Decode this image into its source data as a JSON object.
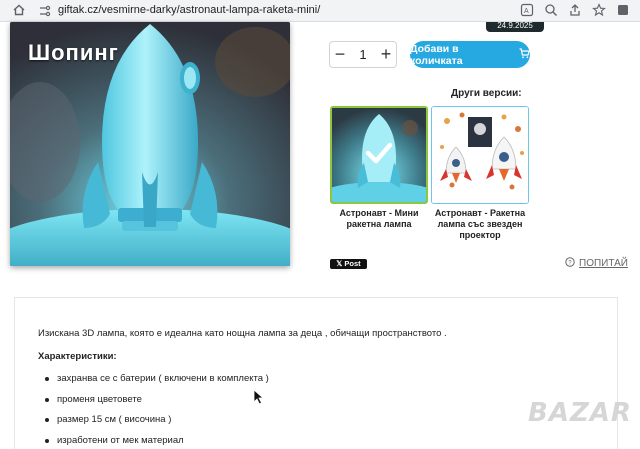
{
  "browser": {
    "url": "giftak.cz/vesmirne-darky/astronaut-lampa-raketa-mini/"
  },
  "product": {
    "shop_badge": "Шопинг",
    "date_chip": "24.9.2025",
    "quantity": "1",
    "qty_minus": "−",
    "qty_plus": "+",
    "add_to_cart_label": "Добави в количката"
  },
  "versions": {
    "title": "Други версии:",
    "items": [
      {
        "label": "Астронавт - Мини ракетна лампа",
        "selected": true
      },
      {
        "label": "Астронавт - Ракетна лампа със звезден проектор",
        "selected": false
      }
    ]
  },
  "social": {
    "post_label": "𝕏 Post",
    "ask_label": "ПОПИТАЙ"
  },
  "description": {
    "text": "Изискана 3D лампа, която е идеална като нощна лампа за деца , обичащи пространството .",
    "characteristics_title": "Характеристики:",
    "features": [
      "захранва се с батерии ( включени в комплекта )",
      "променя цветовете",
      "размер 15 см ( височина )",
      "изработени от мек материал"
    ]
  },
  "watermark": "BAZAR",
  "colors": {
    "accent": "#26a9e0",
    "selected_border": "#8dc63f",
    "lamp_glow": "#6fe0f2"
  }
}
